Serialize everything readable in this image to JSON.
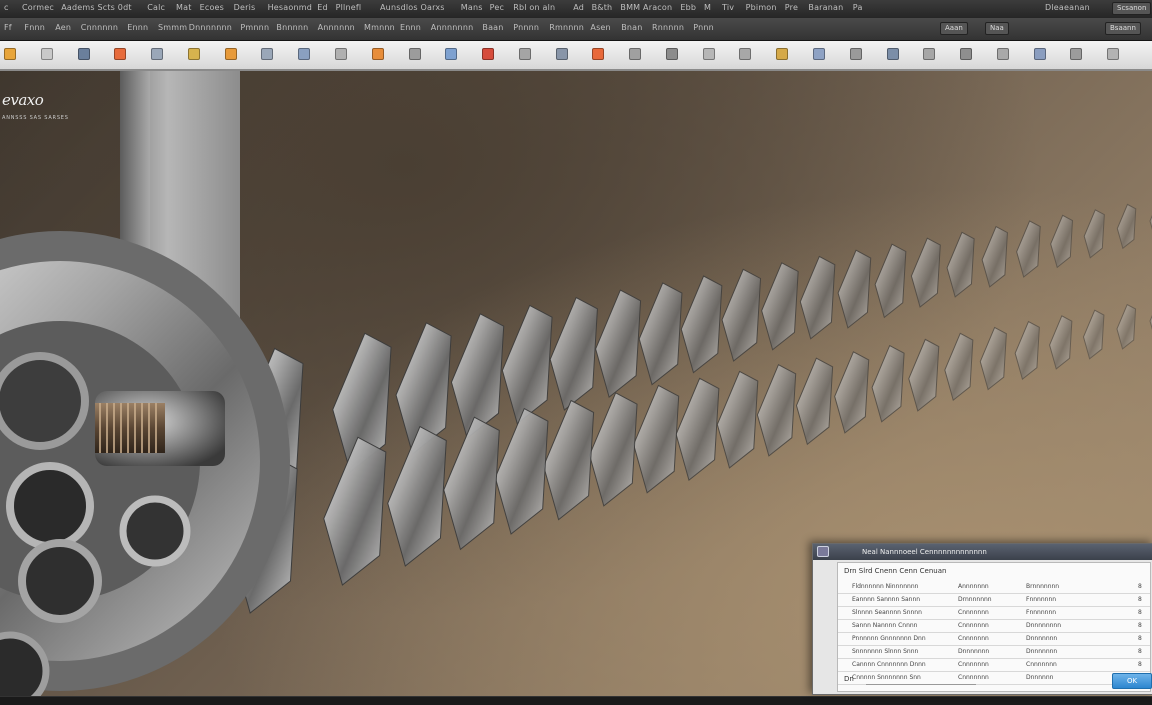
{
  "titlebar": {
    "items": [
      "c",
      "Cormec",
      "Aadems Scts 0dt",
      "Calc",
      "Mat",
      "Ecoes",
      "Deris",
      "Hesaonmd",
      "Ed",
      "Pllnefl",
      "Aunsdlos Oarxs",
      "Mans",
      "Pec",
      "Rbl on aln",
      "Ad",
      "B&th",
      "BMM Aracon",
      "Ebb",
      "M",
      "Tiv",
      "Pbimon",
      "Pre",
      "Baranan",
      "Pa"
    ],
    "right_label": "Dleaeanan",
    "right_button": "Scsanon"
  },
  "menubar": {
    "items": [
      "Ff",
      "Fnnn",
      "Aen",
      "Cnnnnnn",
      "Ennn",
      "Smmm",
      "Dnnnnnnn",
      "Pmnnn",
      "Bnnnnn",
      "Annnnnn",
      "Mmnnn",
      "Ennn",
      "Annnnnnn",
      "Baan",
      "Pnnnn",
      "Rmnnnn",
      "Asen",
      "Bnan",
      "Rnnnnn",
      "Pnnn"
    ],
    "right_buttons": [
      "Aaan",
      "Naa",
      "Bsaann"
    ]
  },
  "toolbar": {
    "icons": [
      {
        "name": "new-file-icon",
        "color": "#e8a53a"
      },
      {
        "name": "open-icon",
        "color": "#c9c9c9"
      },
      {
        "name": "save-icon",
        "color": "#6a7f9c"
      },
      {
        "name": "cut-icon",
        "color": "#e76b3c"
      },
      {
        "name": "copy-icon",
        "color": "#9aa7b8"
      },
      {
        "name": "paste-icon",
        "color": "#d7b34e"
      },
      {
        "name": "undo-icon",
        "color": "#e79a3a"
      },
      {
        "name": "redo-icon",
        "color": "#9aa7b8"
      },
      {
        "name": "select-icon",
        "color": "#8aa0c0"
      },
      {
        "name": "move-icon",
        "color": "#b0b0b0"
      },
      {
        "name": "rotate-icon",
        "color": "#e78d3a"
      },
      {
        "name": "scale-icon",
        "color": "#9c9c9c"
      },
      {
        "name": "line-icon",
        "color": "#7ea1d0"
      },
      {
        "name": "arc-icon",
        "color": "#d64c3c"
      },
      {
        "name": "circle-icon",
        "color": "#a5a5a5"
      },
      {
        "name": "rectangle-icon",
        "color": "#8895a8"
      },
      {
        "name": "extrude-icon",
        "color": "#e8693a"
      },
      {
        "name": "revolve-icon",
        "color": "#a0a0a0"
      },
      {
        "name": "fillet-icon",
        "color": "#8c8c8c"
      },
      {
        "name": "chamfer-icon",
        "color": "#b6b6b6"
      },
      {
        "name": "gear-icon",
        "color": "#a8a8a8"
      },
      {
        "name": "measure-icon",
        "color": "#d5a948"
      },
      {
        "name": "layer-icon",
        "color": "#8ea2c4"
      },
      {
        "name": "render-icon",
        "color": "#9a9a9a"
      },
      {
        "name": "zoom-icon",
        "color": "#7b8ea8"
      },
      {
        "name": "pan-icon",
        "color": "#a6a6a6"
      },
      {
        "name": "orbit-icon",
        "color": "#8e8e8e"
      },
      {
        "name": "settings-icon",
        "color": "#a9a9a9"
      },
      {
        "name": "help-icon",
        "color": "#8a9dbf"
      },
      {
        "name": "grid-icon",
        "color": "#9c9c9c"
      },
      {
        "name": "snap-icon",
        "color": "#b3b3b3"
      }
    ]
  },
  "viewport": {
    "logo": "evaxo",
    "logo_sub": "ANNSSS SAS SARSES"
  },
  "dialog": {
    "title": "Neal Nannnoeel Cennnnnnnnnnnnn",
    "subtitle": "Drn Slrd Cnenn Cenn Cenuan",
    "rows": [
      [
        "Fldnnnnnn Ninnnnnnn",
        "Annnnnnn",
        "Brnnnnnnn",
        "8"
      ],
      [
        "Eannnn Sannnn Sannn",
        "Drnnnnnnn",
        "Fnnnnnnn",
        "8"
      ],
      [
        "Slnnnn Seannnn Snnnn",
        "Cnnnnnnn",
        "Fnnnnnnn",
        "8"
      ],
      [
        "Sannn Nannnn Cnnnn",
        "Cnnnnnnn",
        "Dnnnnnnnn",
        "8"
      ],
      [
        "Pnnnnnn Gnnnnnnn Dnn",
        "Cnnnnnnn",
        "Dnnnnnnn",
        "8"
      ],
      [
        "Snnnnnnn Slnnn Snnn",
        "Dnnnnnnn",
        "Dnnnnnnn",
        "8"
      ],
      [
        "Cannnn Cnnnnnnn Dnnn",
        "Cnnnnnnn",
        "Cnnnnnnn",
        "8"
      ],
      [
        "Cnnnnn Snnnnnnn Snn",
        "Cnnnnnnn",
        "Dnnnnnn",
        "8"
      ]
    ],
    "footer_label": "Dn",
    "ok_button": "OK"
  }
}
